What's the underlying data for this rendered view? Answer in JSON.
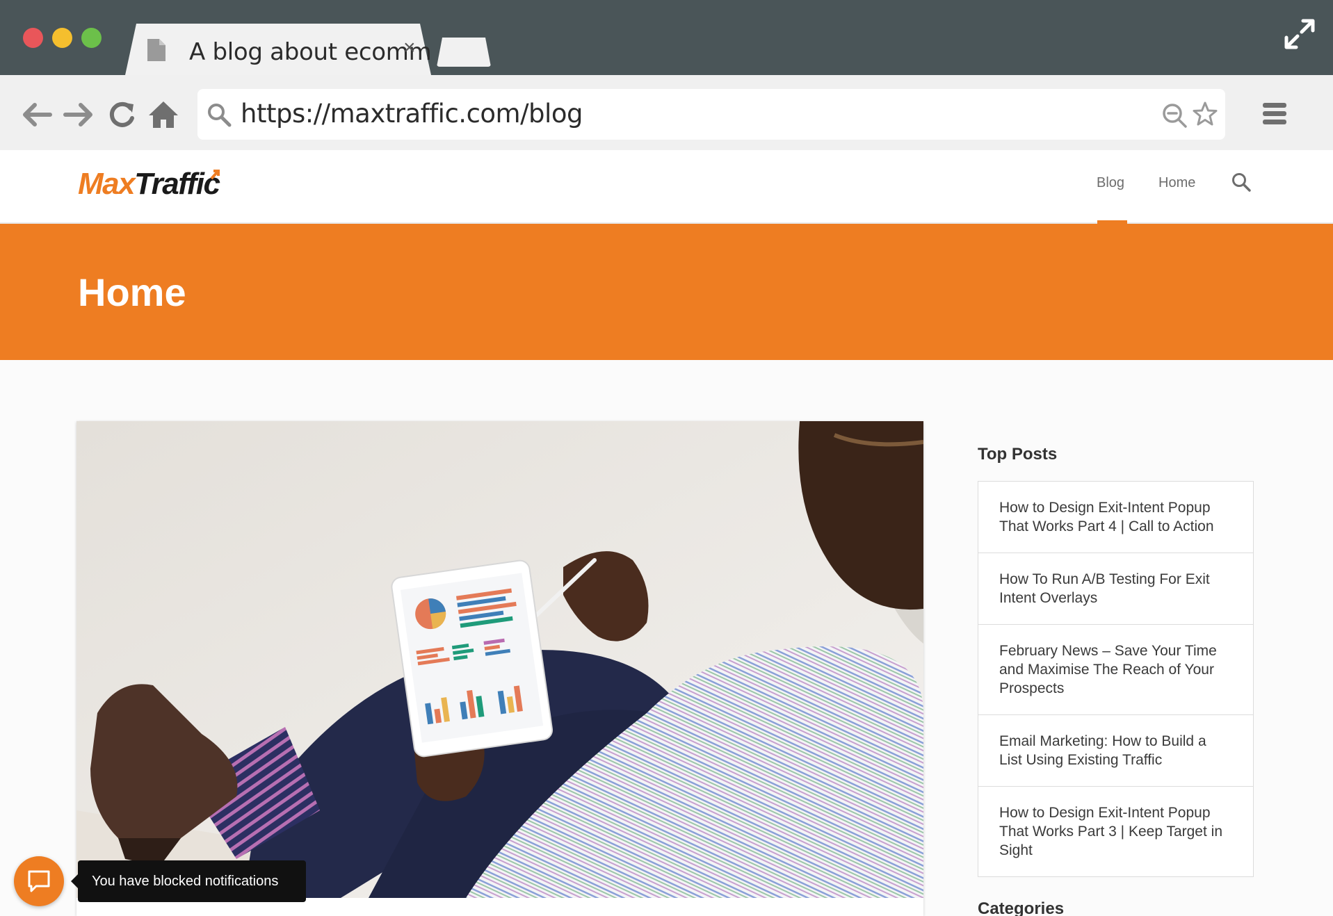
{
  "browser": {
    "tab_title": "A blog about ecomm",
    "tab_close": "×",
    "url": "https://maxtraffic.com/blog",
    "icons": {
      "back": "arrow-left-icon",
      "forward": "arrow-right-icon",
      "reload": "reload-icon",
      "home": "home-icon",
      "search": "search-icon",
      "zoom": "zoom-out-icon",
      "bookmark": "star-icon",
      "menu": "hamburger-menu-icon",
      "fullscreen": "fullscreen-icon"
    }
  },
  "site": {
    "logo_max": "Max",
    "logo_traffic": "Traffic",
    "nav": {
      "blog": "Blog",
      "home": "Home"
    },
    "accent_color": "#ee7d22"
  },
  "hero": {
    "title": "Home"
  },
  "sidebar": {
    "top_posts_heading": "Top Posts",
    "top_posts": [
      "How to Design Exit-Intent Popup That Works Part 4 | Call to Action",
      "How To Run A/B Testing For Exit Intent Overlays",
      "February News – Save Your Time and Maximise The Reach of Your Prospects",
      "Email Marketing: How to Build a List Using Existing Traffic",
      "How to Design Exit-Intent Popup That Works Part 3 | Keep Target in Sight"
    ],
    "categories_heading": "Categories"
  },
  "notification": {
    "text": "You have blocked notifications"
  }
}
